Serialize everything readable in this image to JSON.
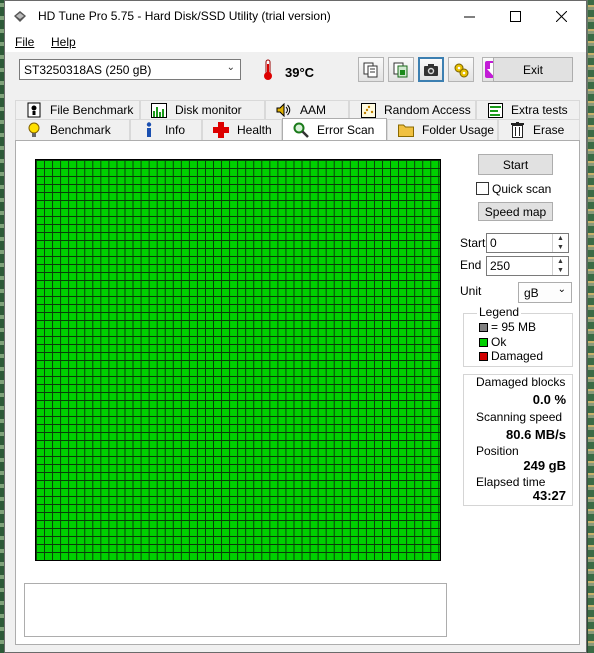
{
  "window": {
    "title": "HD Tune Pro 5.75 - Hard Disk/SSD Utility (trial version)"
  },
  "menu": {
    "file": "File",
    "help": "Help"
  },
  "toolbar": {
    "drive": "ST3250318AS (250 gB)",
    "temperature": "39°C",
    "exit_label": "Exit",
    "icons": [
      "copy-icon",
      "save-icon",
      "camera-icon",
      "options-icon",
      "download-icon"
    ]
  },
  "tabs": {
    "row1": [
      "File Benchmark",
      "Disk monitor",
      "AAM",
      "Random Access",
      "Extra tests"
    ],
    "row2": [
      "Benchmark",
      "Info",
      "Health",
      "Error Scan",
      "Folder Usage",
      "Erase"
    ],
    "selected": "Error Scan"
  },
  "error_scan": {
    "start_button": "Start",
    "quick_scan_label": "Quick scan",
    "quick_scan_checked": false,
    "speed_map_button": "Speed map",
    "start_label": "Start",
    "start_value": "0",
    "end_label": "End",
    "end_value": "250",
    "unit_label": "Unit",
    "unit_value": "gB",
    "legend": {
      "title": "Legend",
      "block": "= 95 MB",
      "ok": "Ok",
      "damaged": "Damaged",
      "colors": {
        "block": "#808080",
        "ok": "#00d000",
        "damaged": "#d00000"
      }
    },
    "stats": {
      "damaged_blocks_label": "Damaged blocks",
      "damaged_blocks_value": "0.0",
      "damaged_blocks_unit": "%",
      "scanning_speed_label": "Scanning speed",
      "scanning_speed_value": "80.6 MB/s",
      "position_label": "Position",
      "position_value": "249 gB",
      "elapsed_label": "Elapsed time",
      "elapsed_value": "43:27"
    },
    "grid": {
      "block_status": "all-ok",
      "ok_color": "#00d000"
    }
  }
}
